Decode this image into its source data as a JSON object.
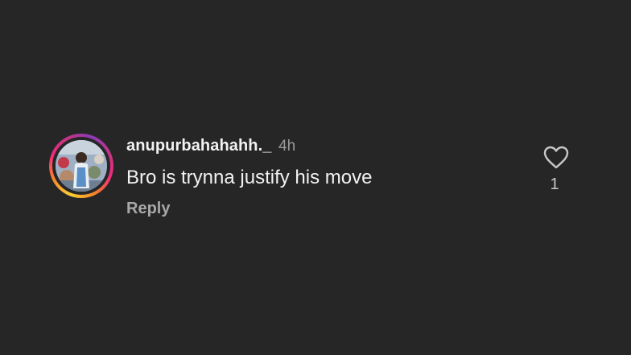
{
  "comment": {
    "username": "anupurbahahahh._",
    "timestamp": "4h",
    "text": "Bro is trynna justify his move",
    "reply_label": "Reply",
    "like_count": "1",
    "icons": {
      "like": "heart-outline-icon"
    },
    "colors": {
      "background": "#262626",
      "ring_gradient": [
        "#f9ce34",
        "#f58529",
        "#ee2a7b",
        "#c13584",
        "#8a3ab9"
      ],
      "text_primary": "#f2f2f2",
      "text_secondary": "#9a9a9a"
    }
  }
}
